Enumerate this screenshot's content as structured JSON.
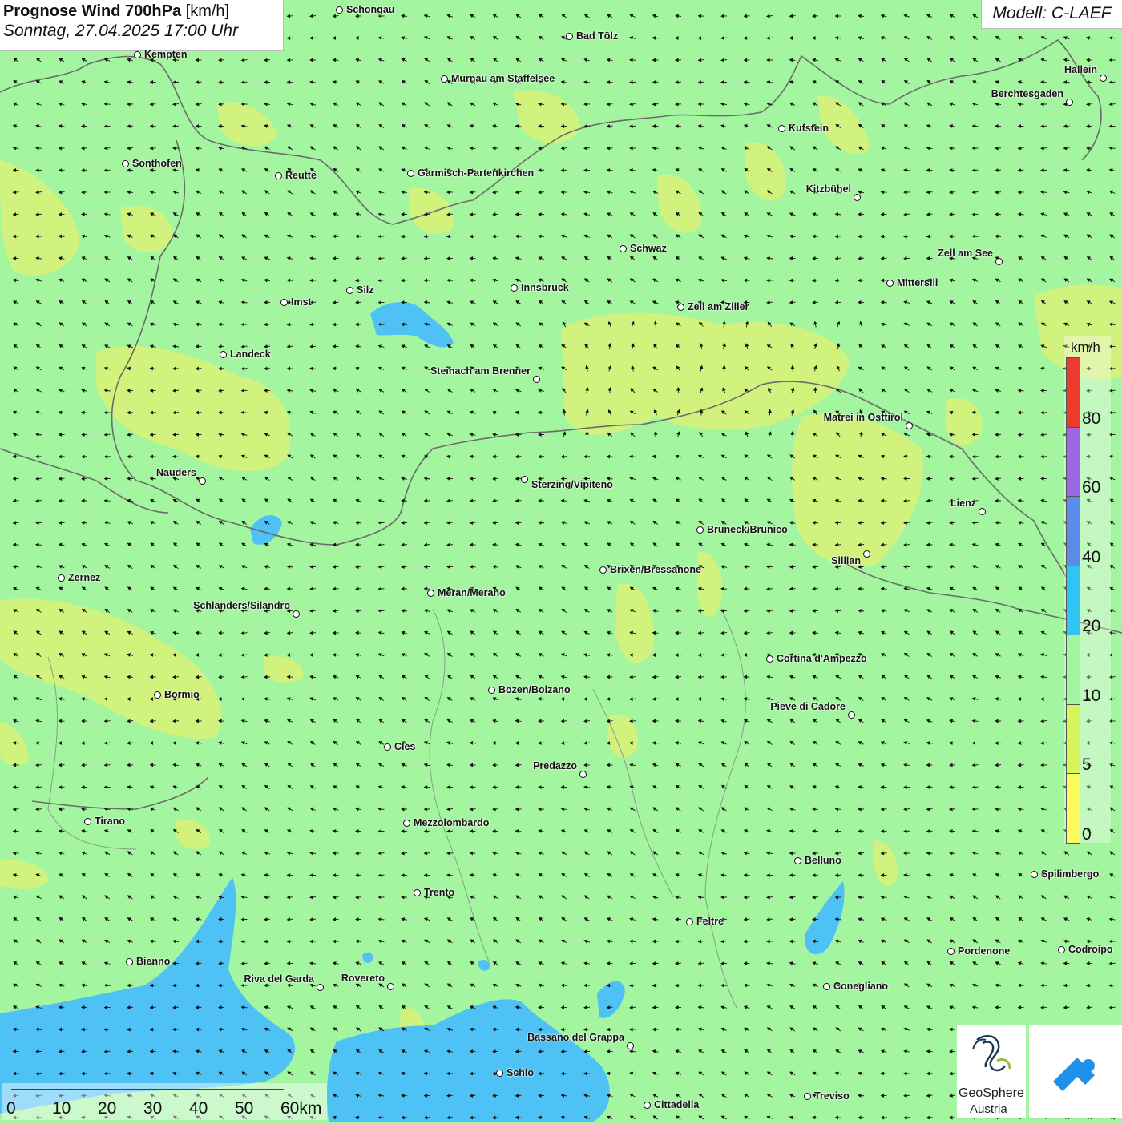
{
  "header": {
    "title_bold": "Prognose Wind 700hPa",
    "title_unit": "[km/h]",
    "subtitle": "Sonntag, 27.04.2025 17:00 Uhr",
    "model": "Modell: C-LAEF"
  },
  "legend": {
    "unit": "km/h",
    "ticks": [
      "80",
      "60",
      "40",
      "20",
      "10",
      "5",
      "0"
    ],
    "colors": [
      "#f03a2e",
      "#9d68e6",
      "#5b8cea",
      "#2fc4f2",
      "#a3f5a0",
      "#d7f55a",
      "#fafa5c"
    ]
  },
  "scale": {
    "labels": [
      "0",
      "10",
      "20",
      "30",
      "40",
      "50",
      "60km"
    ]
  },
  "logos": {
    "geosphere_line1": "GeoSphere",
    "geosphere_line2": "Austria"
  },
  "colors": {
    "background": "#a3f5a0",
    "calm_yellow": "#d7f27a",
    "lake_blue": "#4fc2f5",
    "border_gray": "#6b6b6b"
  },
  "cities": [
    {
      "name": "Schongau"
    },
    {
      "name": "Bad Tölz"
    },
    {
      "name": "Kempten"
    },
    {
      "name": "Murnau am Staffelsee"
    },
    {
      "name": "Hallein"
    },
    {
      "name": "Berchtesgaden"
    },
    {
      "name": "Kufstein"
    },
    {
      "name": "Sonthofen"
    },
    {
      "name": "Reutte"
    },
    {
      "name": "Garmisch-Partenkirchen"
    },
    {
      "name": "Kitzbühel"
    },
    {
      "name": "Schwaz"
    },
    {
      "name": "Zell am See"
    },
    {
      "name": "Mittersill"
    },
    {
      "name": "Silz"
    },
    {
      "name": "Innsbruck"
    },
    {
      "name": "Imst"
    },
    {
      "name": "Zell am Ziller"
    },
    {
      "name": "Landeck"
    },
    {
      "name": "Steinach am Brenner"
    },
    {
      "name": "Matrei in Osttirol"
    },
    {
      "name": "Nauders"
    },
    {
      "name": "Sterzing/Vipiteno"
    },
    {
      "name": "Lienz"
    },
    {
      "name": "Bruneck/Brunico"
    },
    {
      "name": "Sillian"
    },
    {
      "name": "Brixen/Bressanone"
    },
    {
      "name": "Zernez"
    },
    {
      "name": "Meran/Merano"
    },
    {
      "name": "Schlanders/Silandro"
    },
    {
      "name": "Cortina d'Ampezzo"
    },
    {
      "name": "Bozen/Bolzano"
    },
    {
      "name": "Bormio"
    },
    {
      "name": "Pieve di Cadore"
    },
    {
      "name": "Cles"
    },
    {
      "name": "Predazzo"
    },
    {
      "name": "Tirano"
    },
    {
      "name": "Mezzolombardo"
    },
    {
      "name": "Belluno"
    },
    {
      "name": "Spilimbergo"
    },
    {
      "name": "Trento"
    },
    {
      "name": "Feltre"
    },
    {
      "name": "Pordenone"
    },
    {
      "name": "Codroipo"
    },
    {
      "name": "Bienno"
    },
    {
      "name": "Riva del Garda"
    },
    {
      "name": "Rovereto"
    },
    {
      "name": "Conegliano"
    },
    {
      "name": "Bassano del Grappa"
    },
    {
      "name": "Schio"
    },
    {
      "name": "Treviso"
    },
    {
      "name": "Cittadella"
    }
  ]
}
